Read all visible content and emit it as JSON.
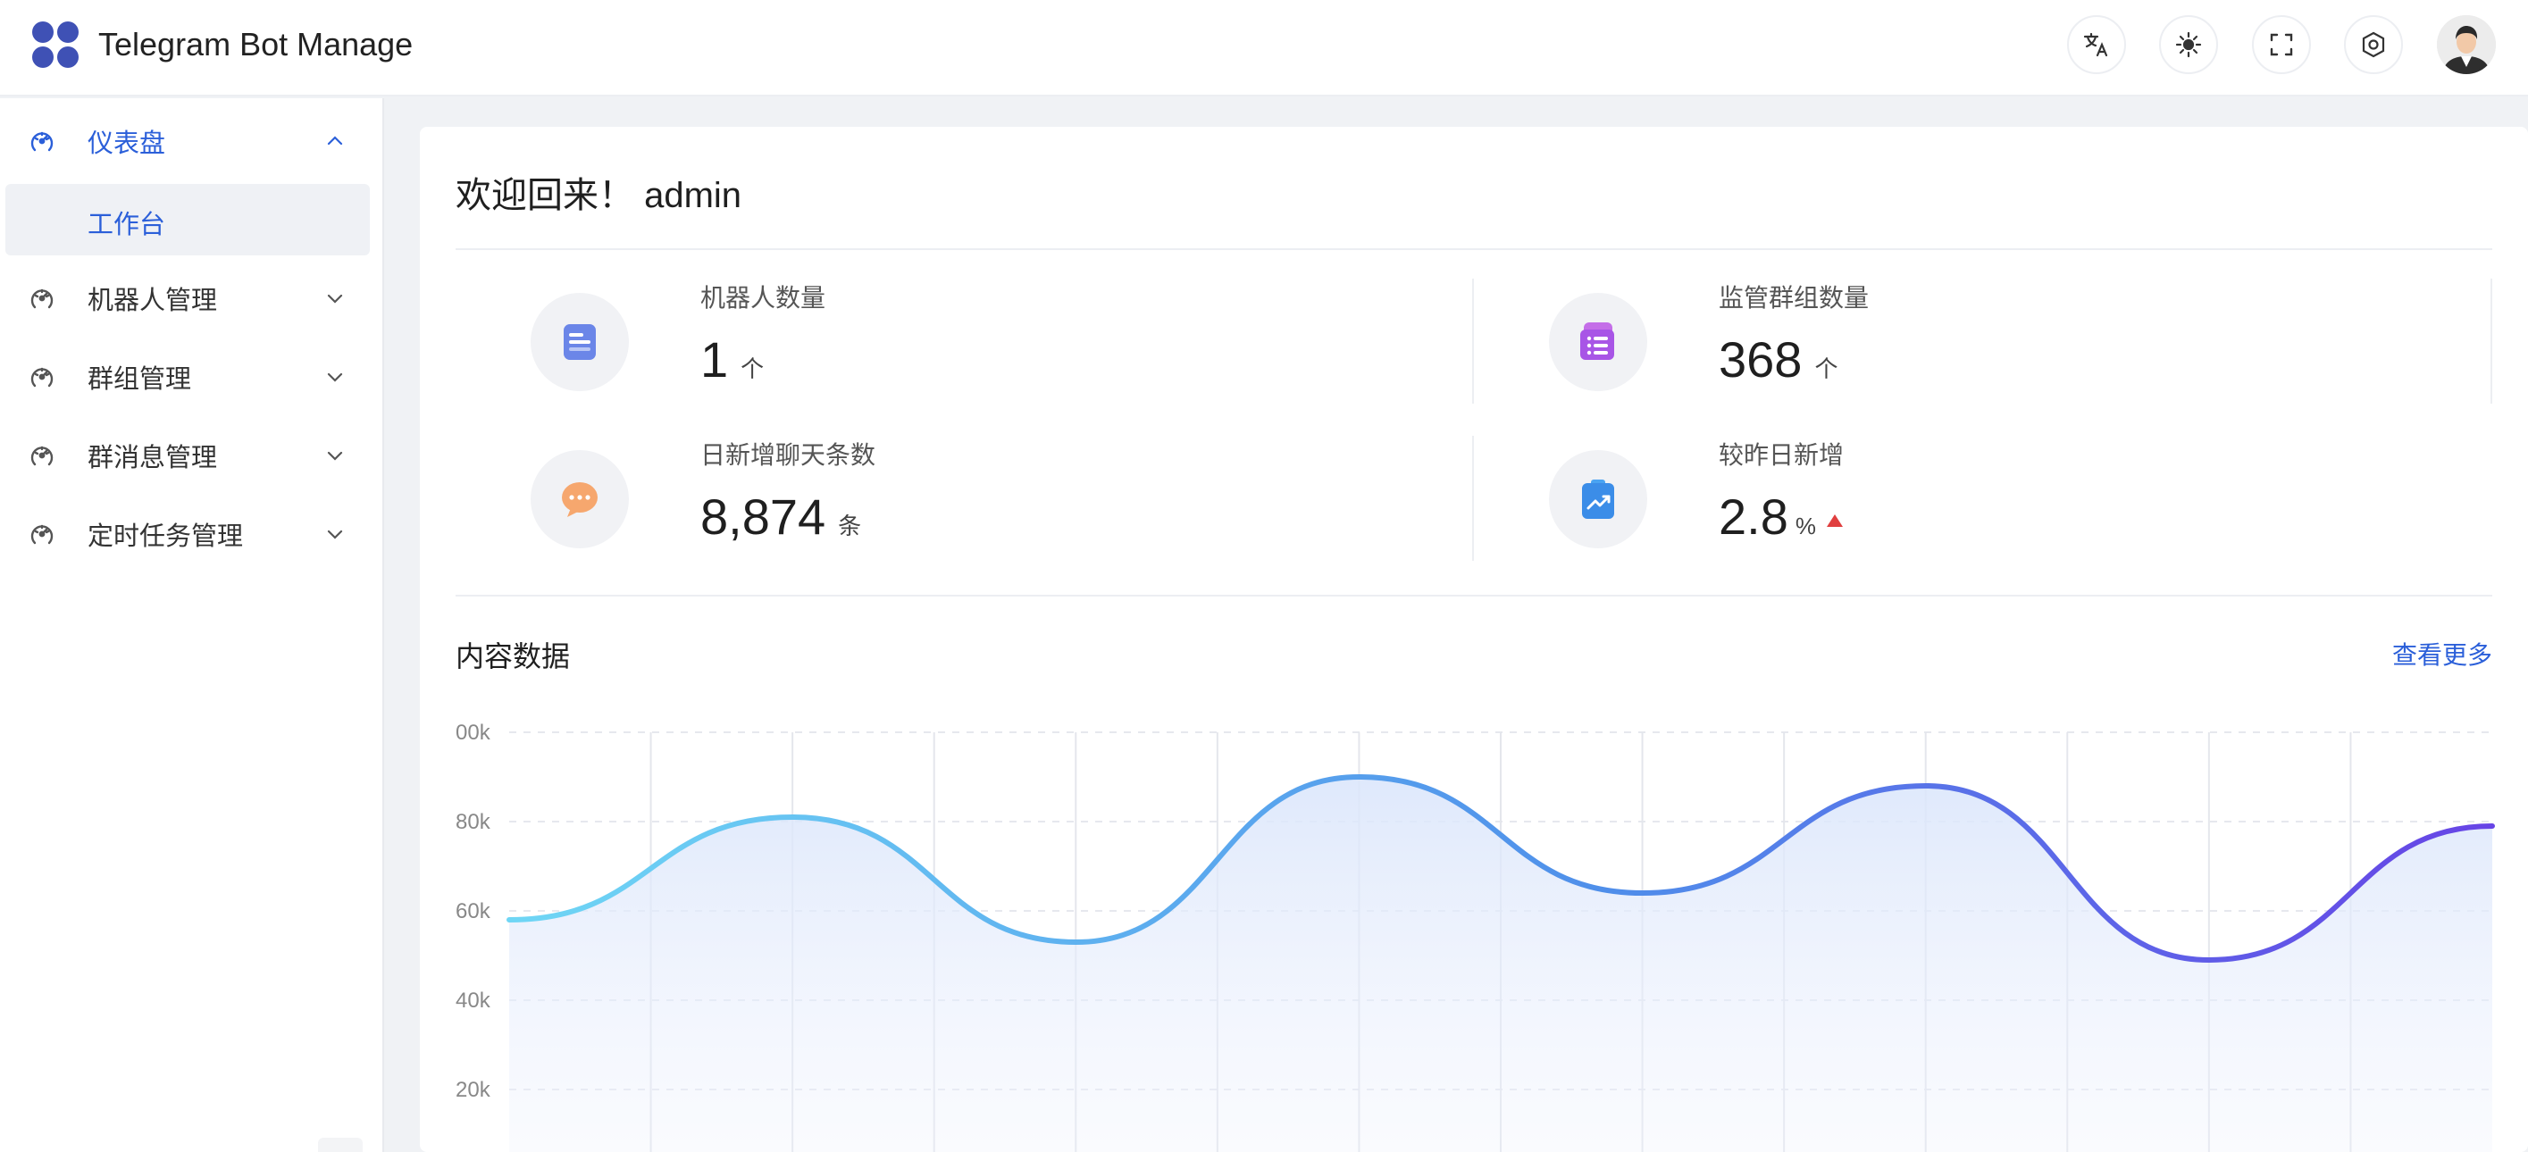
{
  "header": {
    "title": "Telegram Bot Manage",
    "icons": [
      "translate-icon",
      "theme-sun-icon",
      "fullscreen-icon",
      "settings-icon"
    ]
  },
  "sidebar": {
    "items": [
      {
        "label": "仪表盘",
        "expanded": true,
        "children": [
          {
            "label": "工作台",
            "active": true
          }
        ]
      },
      {
        "label": "机器人管理",
        "expanded": false
      },
      {
        "label": "群组管理",
        "expanded": false
      },
      {
        "label": "群消息管理",
        "expanded": false
      },
      {
        "label": "定时任务管理",
        "expanded": false
      }
    ]
  },
  "main": {
    "welcome": "欢迎回来！ admin",
    "stats": [
      {
        "label": "机器人数量",
        "value": "1",
        "unit": "个",
        "icon": "document-icon"
      },
      {
        "label": "监管群组数量",
        "value": "368",
        "unit": "个",
        "icon": "group-list-icon"
      },
      {
        "label": "日新增聊天条数",
        "value": "8,874",
        "unit": "条",
        "icon": "chat-bubble-icon"
      },
      {
        "label": "较昨日新增",
        "value": "2.8",
        "unit": "%",
        "icon": "growth-chart-icon",
        "trend": "up"
      }
    ],
    "section_title": "内容数据",
    "more_link": "查看更多"
  },
  "colors": {
    "accent": "#2b5fd9",
    "line_start": "#6fd6f5",
    "line_end": "#6744e6",
    "trend_up": "#e03f3f"
  },
  "chart_data": {
    "type": "area",
    "y_tick_labels": [
      "00k",
      "80k",
      "60k",
      "40k",
      "20k"
    ],
    "ylim": [
      0,
      100000
    ],
    "grid": true,
    "series": [
      {
        "values": [
          58000,
          81000,
          53000,
          90000,
          64000,
          88000,
          49000,
          79000
        ]
      }
    ]
  }
}
